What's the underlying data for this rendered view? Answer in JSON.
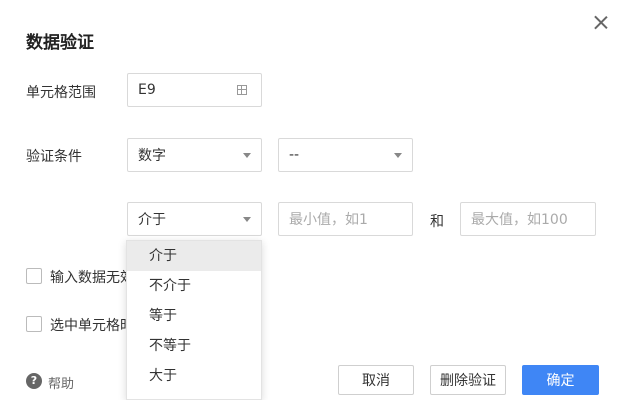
{
  "dialog": {
    "title": "数据验证"
  },
  "range": {
    "label": "单元格范围",
    "value": "E9"
  },
  "condition": {
    "label": "验证条件",
    "type_value": "数字",
    "sub_value": "--",
    "operator_value": "介于",
    "min_placeholder": "最小值，如1",
    "and_label": "和",
    "max_placeholder": "最大值，如100"
  },
  "options": {
    "invalid_label": "输入数据无效",
    "select_label": "选中单元格时"
  },
  "operator_dropdown": {
    "items": [
      "介于",
      "不介于",
      "等于",
      "不等于",
      "大于"
    ]
  },
  "footer": {
    "help_label": "帮助",
    "cancel_label": "取消",
    "delete_label": "删除验证",
    "ok_label": "确定"
  },
  "colors": {
    "primary": "#3f86f5"
  },
  "icons": [
    "close-icon",
    "grid-icon",
    "chevron-down-icon",
    "help-icon"
  ]
}
